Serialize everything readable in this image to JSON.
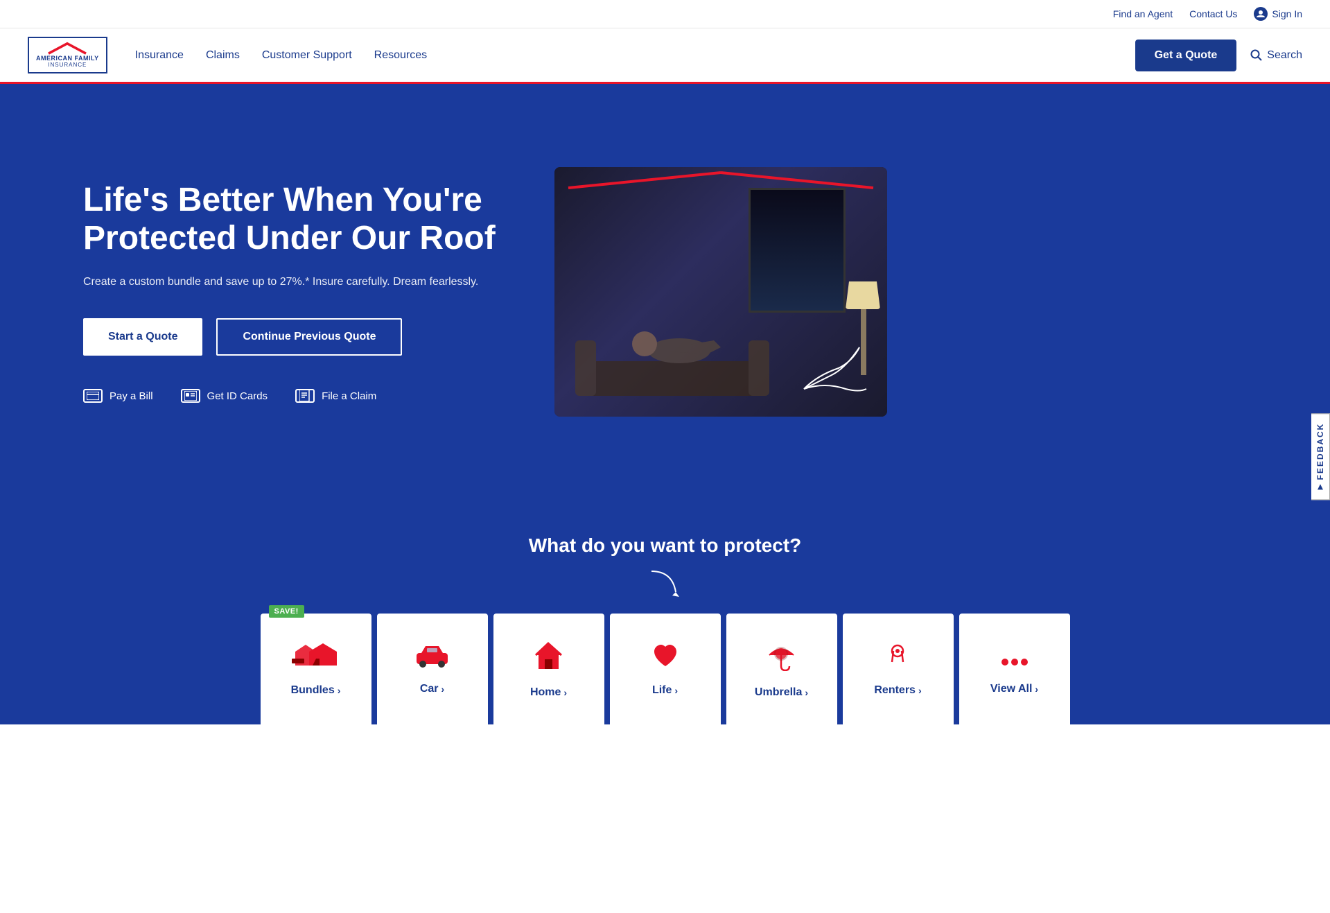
{
  "utility_bar": {
    "find_agent": "Find an Agent",
    "contact_us": "Contact Us",
    "sign_in": "Sign In"
  },
  "main_nav": {
    "logo_line1": "AMERICAN FAMILY",
    "logo_line2": "INSURANCE",
    "insurance": "Insurance",
    "claims": "Claims",
    "customer_support": "Customer Support",
    "resources": "Resources",
    "get_quote": "Get a Quote",
    "search": "Search"
  },
  "hero": {
    "title": "Life's Better When You're Protected Under Our Roof",
    "subtitle": "Create a custom bundle and save up to 27%.* Insure carefully. Dream fearlessly.",
    "start_quote": "Start a Quote",
    "continue_quote": "Continue Previous Quote",
    "pay_bill": "Pay a Bill",
    "get_id_cards": "Get ID Cards",
    "file_claim": "File a Claim"
  },
  "protect_section": {
    "title": "What do you want to protect?"
  },
  "categories": [
    {
      "label": "Bundles",
      "icon": "bundles",
      "save_badge": "SAVE!",
      "show_badge": true
    },
    {
      "label": "Car",
      "icon": "car",
      "show_badge": false
    },
    {
      "label": "Home",
      "icon": "home",
      "show_badge": false
    },
    {
      "label": "Life",
      "icon": "life",
      "show_badge": false
    },
    {
      "label": "Umbrella",
      "icon": "umbrella",
      "show_badge": false
    },
    {
      "label": "Renters",
      "icon": "renters",
      "show_badge": false
    },
    {
      "label": "View All",
      "icon": "more",
      "show_badge": false
    }
  ],
  "feedback": "FEEDBACK"
}
